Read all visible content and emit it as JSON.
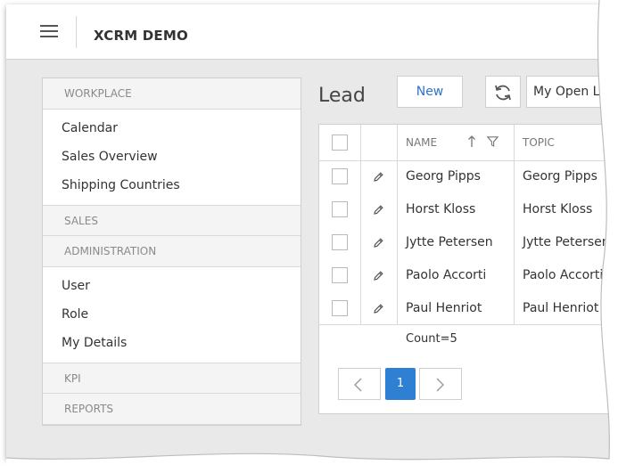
{
  "app": {
    "title": "XCRM DEMO"
  },
  "nav": {
    "groups": [
      {
        "label": "WORKPLACE",
        "items": [
          "Calendar",
          "Sales Overview",
          "Shipping Countries"
        ]
      },
      {
        "label": "SALES",
        "items": []
      },
      {
        "label": "ADMINISTRATION",
        "items": [
          "User",
          "Role",
          "My Details"
        ]
      },
      {
        "label": "KPI",
        "items": []
      },
      {
        "label": "REPORTS",
        "items": []
      }
    ]
  },
  "toolbar": {
    "page_title": "Lead",
    "new_label": "New",
    "refresh_icon": "refresh-icon",
    "view_selected": "My Open Leads"
  },
  "grid": {
    "columns": [
      "NAME",
      "TOPIC"
    ],
    "sort": "ascending",
    "rows": [
      {
        "name": "Georg Pipps",
        "topic": "Georg Pipps"
      },
      {
        "name": "Horst Kloss",
        "topic": "Horst Kloss"
      },
      {
        "name": "Jytte Petersen",
        "topic": "Jytte Petersen"
      },
      {
        "name": "Paolo Accorti",
        "topic": "Paolo Accorti"
      },
      {
        "name": "Paul Henriot",
        "topic": "Paul Henriot"
      }
    ],
    "count_text": "Count=5"
  },
  "pager": {
    "current_page": "1"
  },
  "colors": {
    "accent": "#2f7fd3",
    "link": "#2f74c8",
    "background": "#e9e9e9"
  }
}
